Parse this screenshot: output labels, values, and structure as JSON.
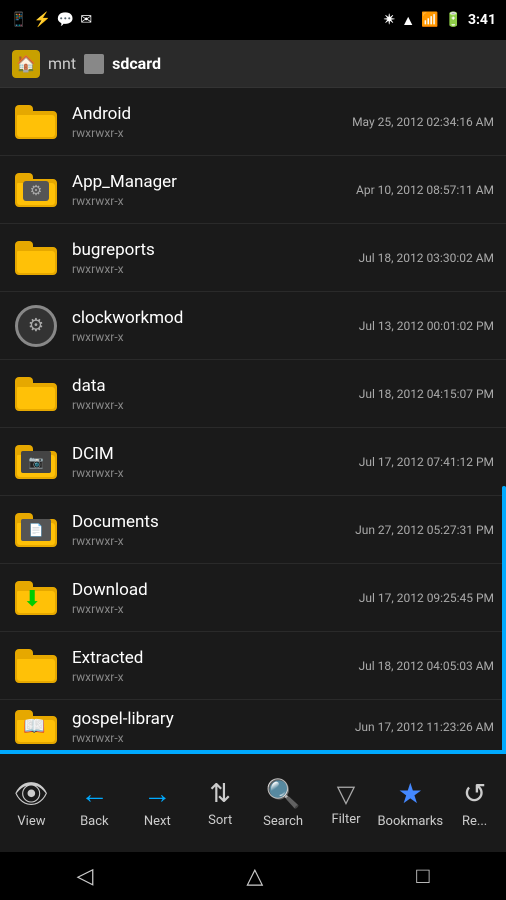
{
  "statusBar": {
    "time": "3:41",
    "icons_left": [
      "notification",
      "usb",
      "chat",
      "mail"
    ],
    "icons_right": [
      "bluetooth",
      "wifi",
      "signal",
      "battery"
    ]
  },
  "pathBar": {
    "home_icon": "🏠",
    "path_parts": [
      "mnt",
      "sdcard"
    ]
  },
  "files": [
    {
      "name": "Android",
      "perms": "rwxrwxr-x",
      "date": "May 25, 2012 02:34:16 AM",
      "type": "folder",
      "special": null
    },
    {
      "name": "App_Manager",
      "perms": "rwxrwxr-x",
      "date": "Apr 10, 2012 08:57:11 AM",
      "type": "folder",
      "special": "gear"
    },
    {
      "name": "bugreports",
      "perms": "rwxrwxr-x",
      "date": "Jul 18, 2012 03:30:02 AM",
      "type": "folder",
      "special": null
    },
    {
      "name": "clockworkmod",
      "perms": "rwxrwxr-x",
      "date": "Jul 13, 2012 00:01:02 PM",
      "type": "folder",
      "special": "settings"
    },
    {
      "name": "data",
      "perms": "rwxrwxr-x",
      "date": "Jul 18, 2012 04:15:07 PM",
      "type": "folder",
      "special": null
    },
    {
      "name": "DCIM",
      "perms": "rwxrwxr-x",
      "date": "Jul 17, 2012 07:41:12 PM",
      "type": "folder",
      "special": "photos"
    },
    {
      "name": "Documents",
      "perms": "rwxrwxr-x",
      "date": "Jun 27, 2012 05:27:31 PM",
      "type": "folder",
      "special": "docs"
    },
    {
      "name": "Download",
      "perms": "rwxrwxr-x",
      "date": "Jul 17, 2012 09:25:45 PM",
      "type": "folder",
      "special": "download"
    },
    {
      "name": "Extracted",
      "perms": "rwxrwxr-x",
      "date": "Jul 18, 2012 04:05:03 AM",
      "type": "folder",
      "special": null
    },
    {
      "name": "gospel-library",
      "perms": "rwxrwxr-x",
      "date": "Jun 17, 2012 11:23:26 AM",
      "type": "folder",
      "special": "book"
    }
  ],
  "toolbar": {
    "buttons": [
      {
        "id": "view",
        "icon": "👁",
        "label": "View"
      },
      {
        "id": "back",
        "icon": "←",
        "label": "Back"
      },
      {
        "id": "next",
        "icon": "→",
        "label": "Next"
      },
      {
        "id": "sort",
        "icon": "⇅",
        "label": "Sort"
      },
      {
        "id": "search",
        "icon": "🔍",
        "label": "Search"
      },
      {
        "id": "filter",
        "icon": "▽",
        "label": "Filter"
      },
      {
        "id": "bookmarks",
        "icon": "★",
        "label": "Bookmarks"
      },
      {
        "id": "refresh",
        "icon": "↺",
        "label": "Re..."
      }
    ]
  },
  "navBar": {
    "back": "◁",
    "home": "△",
    "recent": "□"
  }
}
